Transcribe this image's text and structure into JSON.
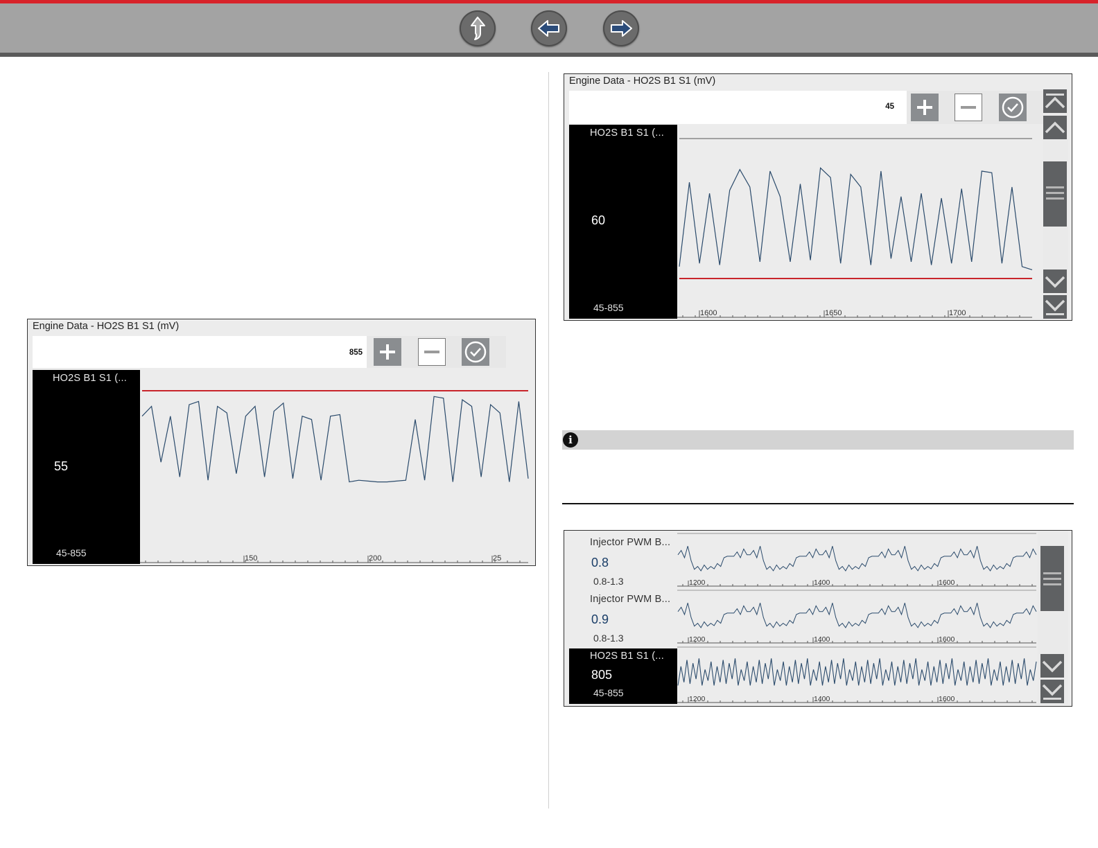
{
  "nav": {
    "buttons": [
      {
        "name": "up",
        "icon": "arrow-up-icon"
      },
      {
        "name": "back",
        "icon": "arrow-left-icon"
      },
      {
        "name": "forward",
        "icon": "arrow-right-icon"
      }
    ]
  },
  "colors": {
    "accent_red": "#d8232a",
    "trace_blue": "#2a4a6b",
    "threshold_red": "#c8242a",
    "panel_bg": "#ececec"
  },
  "panel_left": {
    "title": "Engine Data - HO2S B1 S1 (mV)",
    "threshold_value": "855",
    "buttons": [
      "plus-icon",
      "minus-icon",
      "check-icon"
    ],
    "param": {
      "name": "HO2S B1 S1 (...",
      "value": "55",
      "range": "45-855"
    },
    "chart_data": {
      "type": "line",
      "x_ticks": [
        "150",
        "200",
        "25"
      ],
      "threshold": 855,
      "y_range": [
        45,
        855
      ],
      "series": [
        {
          "values": [
            700,
            760,
            420,
            700,
            330,
            770,
            790,
            310,
            760,
            720,
            350,
            700,
            760,
            330,
            730,
            780,
            320,
            700,
            680,
            310,
            700,
            710,
            300,
            310,
            305,
            300,
            300,
            305,
            310,
            680,
            310,
            820,
            810,
            300,
            800,
            760,
            330,
            770,
            720,
            300,
            790,
            320
          ]
        }
      ]
    }
  },
  "panel_right_top": {
    "title": "Engine Data - HO2S B1 S1 (mV)",
    "threshold_value": "45",
    "buttons": [
      "plus-icon",
      "minus-icon",
      "check-icon"
    ],
    "param": {
      "name": "HO2S B1 S1 (...",
      "value": "60",
      "range": "45-855"
    },
    "chart_data": {
      "type": "line",
      "x_ticks": [
        "1600",
        "1650",
        "1700"
      ],
      "threshold": 45,
      "y_range": [
        45,
        855
      ],
      "series": [
        {
          "values": [
            120,
            650,
            140,
            580,
            130,
            600,
            730,
            620,
            150,
            720,
            560,
            150,
            640,
            160,
            740,
            680,
            140,
            700,
            620,
            130,
            720,
            170,
            560,
            150,
            580,
            130,
            550,
            140,
            610,
            150,
            720,
            710,
            140,
            620,
            120,
            100
          ]
        }
      ]
    },
    "scroll_icons": [
      "scroll-top-icon",
      "scroll-up-icon",
      "scroll-thumb-icon",
      "scroll-down-icon",
      "scroll-bottom-icon"
    ]
  },
  "panel_right_bottom": {
    "params": [
      {
        "name": "Injector PWM B...",
        "value": "0.8",
        "range": "0.8-1.3",
        "x_ticks": [
          "1200",
          "1400",
          "1600"
        ]
      },
      {
        "name": "Injector PWM B...",
        "value": "0.9",
        "range": "0.8-1.3",
        "x_ticks": [
          "1200",
          "1400",
          "1600"
        ]
      },
      {
        "name": "HO2S B1 S1 (...",
        "value": "805",
        "range": "45-855",
        "x_ticks": [
          "1200",
          "1400",
          "1600"
        ]
      }
    ],
    "scroll_icons": [
      "scroll-thumb-icon",
      "scroll-down-icon",
      "scroll-bottom-icon"
    ]
  },
  "note": {
    "icon": "info-icon"
  }
}
